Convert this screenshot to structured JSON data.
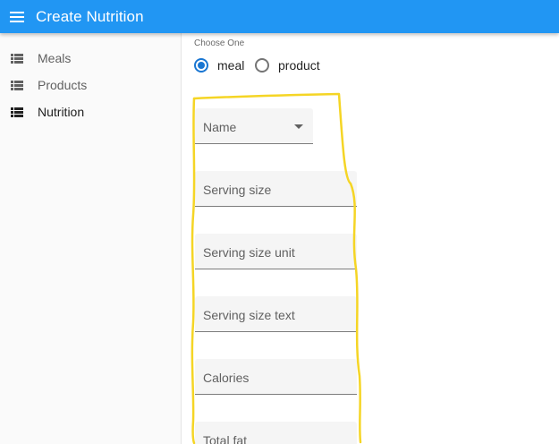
{
  "app": {
    "title": "Create Nutrition",
    "menu_icon": "hamburger-menu-icon",
    "bar_color": "#2196f3"
  },
  "sidebar": {
    "items": [
      {
        "label": "Meals",
        "icon": "list-icon"
      },
      {
        "label": "Products",
        "icon": "list-icon"
      },
      {
        "label": "Nutrition",
        "icon": "list-icon",
        "active": true
      }
    ]
  },
  "form": {
    "choose_label": "Choose One",
    "radio_options": [
      {
        "label": "meal",
        "checked": true
      },
      {
        "label": "product",
        "checked": false
      }
    ],
    "name_select": {
      "placeholder": "Name"
    },
    "fields": [
      {
        "label": "Serving size"
      },
      {
        "label": "Serving size unit"
      },
      {
        "label": "Serving size text"
      },
      {
        "label": "Calories"
      },
      {
        "label": "Total fat"
      }
    ]
  },
  "annotation": {
    "color": "#f5d525"
  }
}
